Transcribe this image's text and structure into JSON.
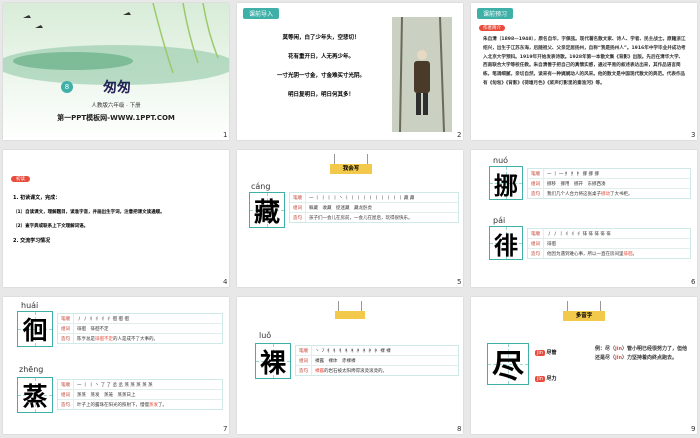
{
  "slides": {
    "s1": {
      "unit": "8",
      "title": "匆匆",
      "grade": "人教版六年级 · 下册",
      "site": "第一PPT模板网-WWW.1PPT.COM",
      "num": "1"
    },
    "s2": {
      "pill": "课前导入",
      "lines": [
        "莫等闲，白了少年头，空悲切！",
        "花有重开日，人无再少年。",
        "一寸光阴一寸金，寸金难买寸光阴。",
        "明日复明日，明日何其多！"
      ],
      "num": "2"
    },
    "s3": {
      "pill": "课前预习",
      "badge": "作者简介",
      "body": "朱自清（1898—1948），原名自华，字佩弦。现代著名散文家、诗人、学者、民主战士。原籍浙江绍兴，出生于江苏东海，后随祖父、父亲定居扬州，自称“我是扬州人”。1916年中学毕业并成功考入北京大学预科。1919年开始发表诗歌。1928年第一本散文集《背影》出版。先后在清华大学、西南联合大学等校任教。朱自清善于把自己的真情实感，通过平易的叙述表达出来，其作品语言简练，笔调细腻，亲切自然，读来有一种娓娓动人的风采。他的散文是中国现代散文的典范。代表作品有《匆匆》《背影》《荷塘月色》《桨声灯影里的秦淮河》等。",
      "num": "3"
    },
    "s4": {
      "badge": "初读",
      "tasks": [
        "1. 初读课文，完成：",
        "（1）自读课文，理解题目，读准字音，并画出生字词，注意把课文读通顺。",
        "（2）查字典或联系上下文理解词语。",
        "2. 交流学习情况"
      ],
      "num": "4"
    },
    "s5": {
      "ribbon": "我会写",
      "pinyin": "cáng",
      "char": "藏",
      "labels": [
        "笔顺",
        "组词",
        "造句"
      ],
      "stroke": "一 丨 丨 丨 丨 丶 丨 丨 丨 丨 丨 丨 丨 丨 丨 丨 藏 藏",
      "words": "躲藏　收藏　捉迷藏　藏龙卧虎",
      "sentence_pre": "孩子们一会儿在房前，一会儿在屋后，玩得很快乐",
      "sentence_hl": "",
      "sentence_post": "。",
      "num": "5"
    },
    "s6": {
      "c1": {
        "pinyin": "nuó",
        "char": "挪",
        "stroke": "一 丨 一 扌 扌 扌 挪 挪 挪",
        "words": "挪移　挪用　挪开　东挪西凑",
        "sentence_pre": "我们几个人合力将这张桌子",
        "sentence_hl": "挪动",
        "sentence_post": "了大书柜。"
      },
      "c2": {
        "pinyin": "pái",
        "char": "徘",
        "stroke": "丿 丿 丨 彳 彳 彳 徘 徘 徘 徘 徘",
        "words": "徘徊",
        "sentence_pre": "他因为遇到难心事，所以一直在房间里",
        "sentence_hl": "徘徊",
        "sentence_post": "。"
      },
      "labels": [
        "笔顺",
        "组词",
        "造句"
      ],
      "num": "6"
    },
    "s7": {
      "c1": {
        "pinyin": "huái",
        "char": "徊",
        "stroke": "丿 丿 彳 彳 彳 彳 徊 徊 徊",
        "words": "徘徊　徘徊不定",
        "sentence_pre": "陈亨总是",
        "sentence_hl": "徘徊不定",
        "sentence_post": "的人是成不了大事的。"
      },
      "c2": {
        "pinyin": "zhēng",
        "char": "蒸",
        "stroke": "一 丨 丨 丶 了 了 丞 丞 蒸 蒸 蒸 蒸 蒸",
        "words": "蒸蒸　蒸发　蒸笼　蒸蒸日上",
        "sentence_pre": "叶子上的露珠在阳光的照射下，慢慢",
        "sentence_hl": "蒸发",
        "sentence_post": "了。"
      },
      "labels": [
        "笔顺",
        "组词",
        "造句"
      ],
      "num": "7"
    },
    "s8": {
      "pinyin": "luǒ",
      "char": "裸",
      "labels": [
        "笔顺",
        "组词",
        "造句"
      ],
      "stroke": "丶 ㇇ 礻 礻 礻 衤 衤 衤 衤 衤 衤 裸 裸",
      "words": "裸露　裸体　赤裸裸",
      "sentence_pre": "",
      "sentence_hl": "裸露",
      "sentence_post": "的岩石被太阳烤得滚烫滚烫的。",
      "num": "8"
    },
    "s9": {
      "ribbon": "多音字",
      "char": "尽",
      "p1": "jìn",
      "p1word": "尽管",
      "p2": "jǐn",
      "p2word": "尽力",
      "ex1_pre": "例：尽（",
      "ex1_py": "jìn",
      "ex1_post": "）管小明已经很努力了，但他还是尽（",
      "ex2_py": "jǐn",
      "ex2_post": "）力坚持着向终点跑去。",
      "num": "9"
    }
  }
}
